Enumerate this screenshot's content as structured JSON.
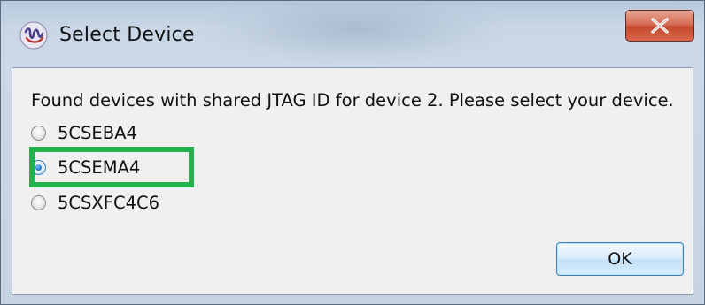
{
  "window": {
    "title": "Select Device",
    "close_label": "X"
  },
  "dialog": {
    "message": "Found devices with shared JTAG ID for device 2. Please select your device.",
    "options": [
      {
        "label": "5CSEBA4",
        "checked": false
      },
      {
        "label": "5CSEMA4",
        "checked": true
      },
      {
        "label": "5CSXFC4C6",
        "checked": false
      }
    ],
    "ok_label": "OK"
  },
  "colors": {
    "highlight": "#22b14c",
    "close_button": "#c44a2f",
    "radio_selected": "#2a7fd2"
  },
  "icons": {
    "app": "quartus-wave-icon",
    "close": "close-x-icon"
  }
}
